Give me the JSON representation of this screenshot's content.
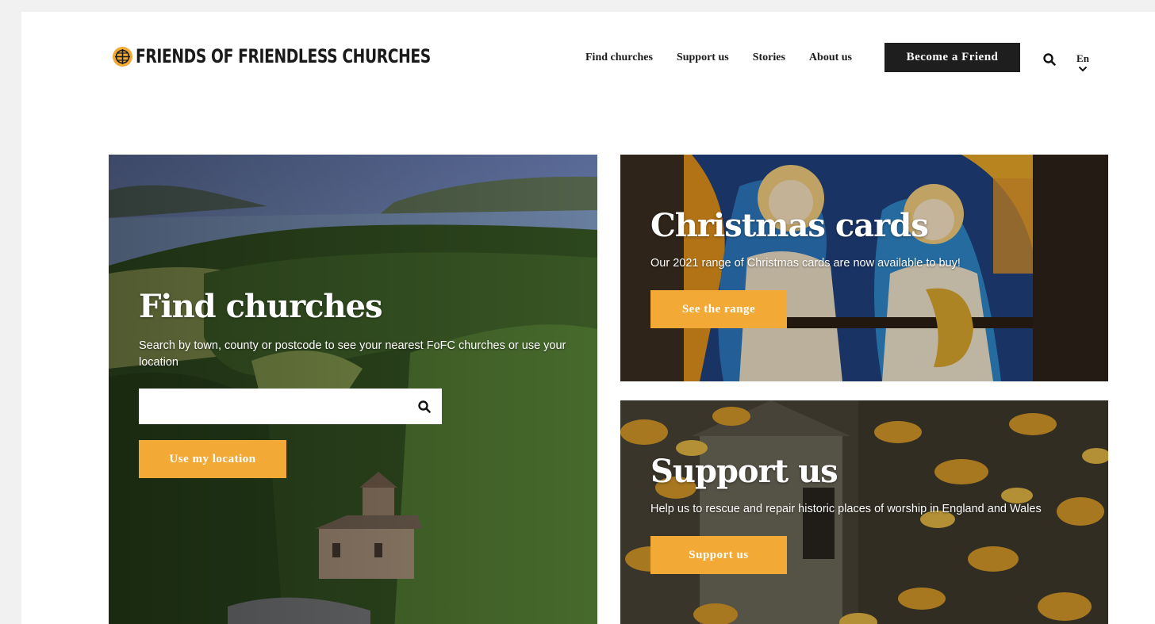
{
  "header": {
    "logo_text": "FRIENDS OF FRIENDLESS CHURCHES",
    "nav": [
      {
        "label": "Find churches"
      },
      {
        "label": "Support us"
      },
      {
        "label": "Stories"
      },
      {
        "label": "About us"
      }
    ],
    "cta_label": "Become a Friend",
    "search_icon": "search-icon",
    "language": "En"
  },
  "cards": {
    "find": {
      "title": "Find churches",
      "description": "Search by town, county or postcode to see your nearest FoFC churches or use your location",
      "search_value": "",
      "search_placeholder": "",
      "button_label": "Use my location"
    },
    "christmas": {
      "title": "Christmas cards",
      "description": "Our 2021 range of Christmas cards are now available to buy!",
      "button_label": "See the range"
    },
    "support": {
      "title": "Support us",
      "description": "Help us to rescue and repair historic places of worship in England and Wales",
      "button_label": "Support us"
    }
  },
  "colors": {
    "accent": "#f3a936",
    "dark": "#1e1e1e",
    "page_bg": "#f1f1f1"
  }
}
